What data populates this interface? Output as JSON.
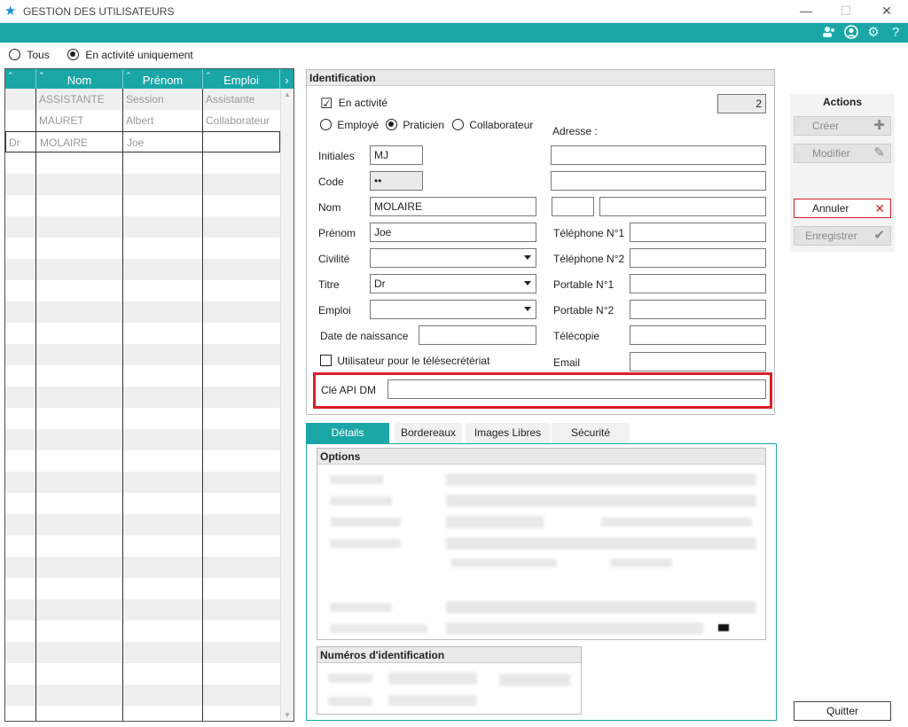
{
  "window": {
    "title": "GESTION DES UTILISATEURS",
    "minimize": "—",
    "maximize": "☐",
    "close": "✕"
  },
  "toolbar": {
    "icons": [
      "users-icon",
      "account-icon",
      "settings-icon",
      "help-icon"
    ],
    "help": "?"
  },
  "filter": {
    "all_label": "Tous",
    "active_label": "En activité uniquement",
    "selected": "active"
  },
  "grid": {
    "columns": [
      "Nom",
      "Prénom",
      "Emploi"
    ],
    "scroll_right": "›",
    "rows": [
      {
        "titre": "",
        "nom": "ASSISTANTE",
        "prenom": "Session",
        "emploi": "Assistante"
      },
      {
        "titre": "",
        "nom": "MAURET",
        "prenom": "Albert",
        "emploi": "Collaborateur"
      },
      {
        "titre": "Dr",
        "nom": "MOLAIRE",
        "prenom": "Joe",
        "emploi": ""
      }
    ]
  },
  "identification": {
    "title": "Identification",
    "active_label": "En activité",
    "active_checked": "☑",
    "id_number": "2",
    "role_employe": "Employé",
    "role_praticien": "Praticien",
    "role_collaborateur": "Collaborateur",
    "role_selected": "Praticien",
    "adresse_label": "Adresse :",
    "initiales_label": "Initiales",
    "initiales_value": "MJ",
    "code_label": "Code",
    "code_value": "••",
    "nom_label": "Nom",
    "nom_value": "MOLAIRE",
    "prenom_label": "Prénom",
    "prenom_value": "Joe",
    "civilite_label": "Civilité",
    "civilite_value": "",
    "titre_label": "Titre",
    "titre_value": "Dr",
    "emploi_label": "Emploi",
    "emploi_value": "",
    "naissance_label": "Date de naissance",
    "telesecretariat_label": "Utilisateur pour le télésecrétériat",
    "tel1_label": "Téléphone N°1",
    "tel2_label": "Téléphone N°2",
    "port1_label": "Portable N°1",
    "port2_label": "Portable N°2",
    "fax_label": "Télécopie",
    "email_label": "Email",
    "api_label": "Clé API DM",
    "api_value": ""
  },
  "actions": {
    "title": "Actions",
    "create": "Créer",
    "modify": "Modifier",
    "cancel": "Annuler",
    "save": "Enregistrer"
  },
  "tabs": [
    "Détails",
    "Bordereaux",
    "Images Libres",
    "Sécurité"
  ],
  "active_tab": "Détails",
  "options_title": "Options",
  "ident_numbers_title": "Numéros d'identification",
  "quit": "Quitter",
  "colors": {
    "teal": "#1ba6a6",
    "highlight_red": "#d81f26"
  }
}
